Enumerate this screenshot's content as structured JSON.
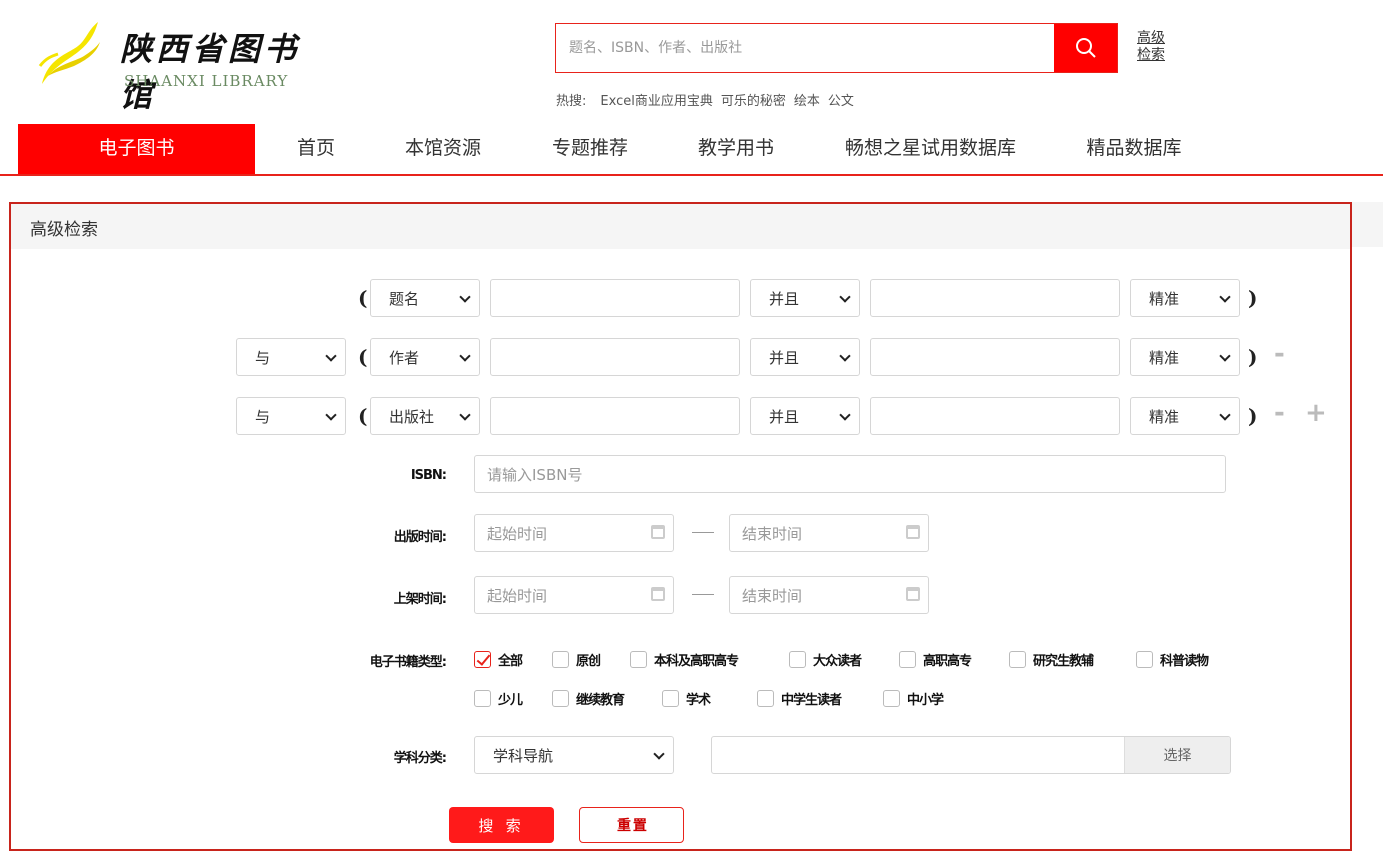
{
  "logo": {
    "cn": "陕西省图书馆",
    "en": "SHAANXI LIBRARY"
  },
  "search": {
    "placeholder": "题名、ISBN、作者、出版社",
    "icon": "search-icon",
    "advanced_label": "高级检索"
  },
  "hot": {
    "label": "热搜:",
    "items": [
      "Excel商业应用宝典",
      "可乐的秘密",
      "绘本",
      "公文"
    ]
  },
  "nav": {
    "items": [
      "电子图书",
      "首页",
      "本馆资源",
      "专题推荐",
      "教学用书",
      "畅想之星试用数据库",
      "精品数据库"
    ],
    "active": 0
  },
  "panel": {
    "title": "高级检索"
  },
  "rows": [
    {
      "connector": "",
      "field": "题名",
      "op": "并且",
      "mode": "精准"
    },
    {
      "connector": "与",
      "field": "作者",
      "op": "并且",
      "mode": "精准"
    },
    {
      "connector": "与",
      "field": "出版社",
      "op": "并且",
      "mode": "精准"
    }
  ],
  "row_controls": {
    "remove": "-",
    "add": "+"
  },
  "isbn": {
    "label": "ISBN:",
    "placeholder": "请输入ISBN号"
  },
  "publish_time": {
    "label": "出版时间:",
    "start_placeholder": "起始时间",
    "end_placeholder": "结束时间"
  },
  "shelf_time": {
    "label": "上架时间:",
    "start_placeholder": "起始时间",
    "end_placeholder": "结束时间"
  },
  "types": {
    "label": "电子书籍类型:",
    "options": [
      {
        "label": "全部",
        "checked": true
      },
      {
        "label": "原创",
        "checked": false
      },
      {
        "label": "本科及高职高专",
        "checked": false
      },
      {
        "label": "大众读者",
        "checked": false
      },
      {
        "label": "高职高专",
        "checked": false
      },
      {
        "label": "研究生教辅",
        "checked": false
      },
      {
        "label": "科普读物",
        "checked": false
      },
      {
        "label": "少儿",
        "checked": false
      },
      {
        "label": "继续教育",
        "checked": false
      },
      {
        "label": "学术",
        "checked": false
      },
      {
        "label": "中学生读者",
        "checked": false
      },
      {
        "label": "中小学",
        "checked": false
      }
    ]
  },
  "subject": {
    "label": "学科分类:",
    "select_value": "学科导航",
    "pick_label": "选择"
  },
  "buttons": {
    "search": "搜 索",
    "reset": "重 置"
  },
  "colors": {
    "accent": "#ff0000",
    "border_red": "#c8241c",
    "logo_yellow": "#f5e500"
  }
}
